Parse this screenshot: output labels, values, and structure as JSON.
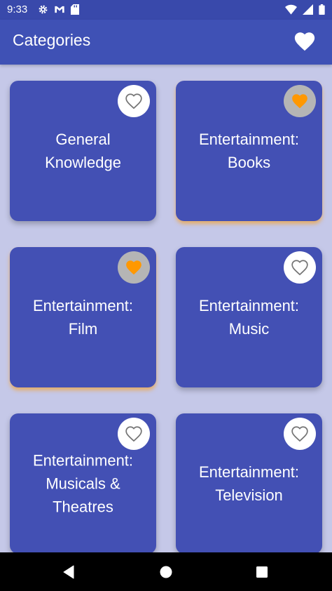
{
  "status_bar": {
    "time": "9:33"
  },
  "app_bar": {
    "title": "Categories"
  },
  "categories": [
    {
      "label_line1": "General",
      "label_line2": "Knowledge",
      "label_line3": "",
      "favorited": false
    },
    {
      "label_line1": "Entertainment:",
      "label_line2": "Books",
      "label_line3": "",
      "favorited": true
    },
    {
      "label_line1": "Entertainment:",
      "label_line2": "Film",
      "label_line3": "",
      "favorited": true
    },
    {
      "label_line1": "Entertainment:",
      "label_line2": "Music",
      "label_line3": "",
      "favorited": false
    },
    {
      "label_line1": "Entertainment:",
      "label_line2": "Musicals &",
      "label_line3": "Theatres",
      "favorited": false
    },
    {
      "label_line1": "Entertainment:",
      "label_line2": "Television",
      "label_line3": "",
      "favorited": false
    }
  ],
  "colors": {
    "app_bar": "#3f51b5",
    "card": "#4350b4",
    "background": "#c5c8e8",
    "favorite_accent": "#ff9800"
  },
  "icons": {
    "app_bar_action": "heart-icon",
    "card_favorite": "heart-outline-icon",
    "card_favorite_active": "heart-filled-icon"
  }
}
